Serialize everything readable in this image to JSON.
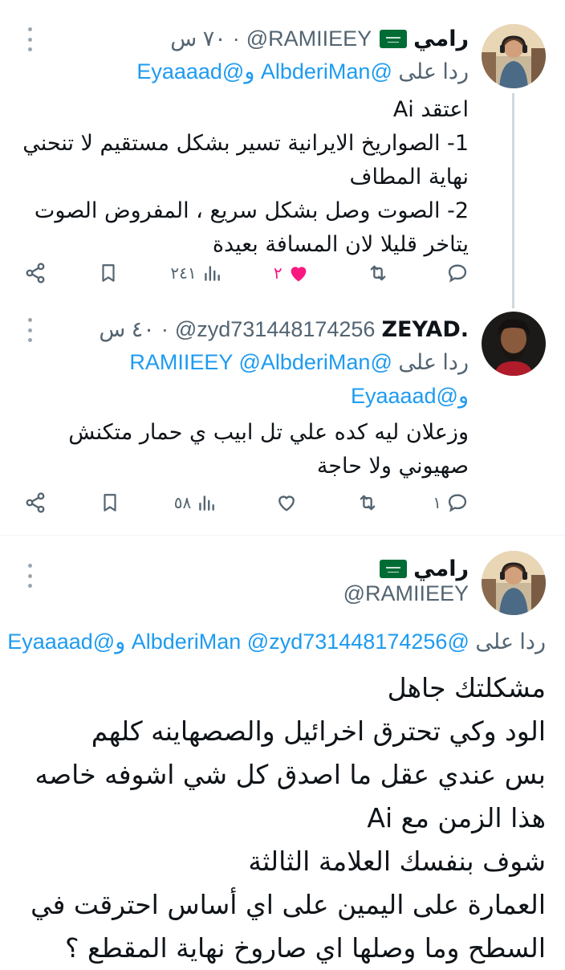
{
  "tweets": [
    {
      "name": "رامي",
      "handle": "@RAMIIEEY",
      "time": "٧٠ س",
      "reply_prefix": "ردا على",
      "reply_mentions": "@AlbderiMan و@Eyaaaad",
      "text": "اعتقد Ai\n1- الصواريخ الايرانية تسير بشكل مستقيم لا تنحني نهاية المطاف\n2- الصوت وصل بشكل سريع ، المفروض الصوت يتاخر قليلا لان المسافة بعيدة",
      "actions": {
        "reply_count": "",
        "retweet_count": "",
        "like_count": "٢",
        "views_count": "٢٤١"
      },
      "like_color": "#f91880"
    },
    {
      "name": "ZEYAD.",
      "handle": "@zyd731448174256",
      "time": "٤٠ س",
      "reply_prefix": "ردا على",
      "reply_mentions": "@RAMIIEEY @AlbderiMan",
      "reply_mentions_2": "و@Eyaaaad",
      "text": "وزعلان ليه كده علي تل ابيب ي حمار متكنش صهيوني ولا حاجة",
      "actions": {
        "reply_count": "١",
        "retweet_count": "",
        "like_count": "",
        "views_count": "٥٨"
      }
    },
    {
      "name": "رامي",
      "handle": "@RAMIIEEY",
      "reply_prefix": "ردا على",
      "reply_mentions": "@AlbderiMan @zyd731448174256 و@Eyaaaad",
      "text": "مشكلتك جاهل\nالود وكي تحترق اخرائيل والصصهاينه كلهم\nبس عندي عقل ما اصدق كل شي اشوفه خاصه هذا الزمن مع Ai\nشوف بنفسك العلامة الثالثة\nالعمارة على اليمين على اي أساس احترقت في السطح وما وصلها اي صاروخ نهاية المقطع ؟"
    }
  ],
  "colors": {
    "accent": "#1d9bf0",
    "muted": "#536471",
    "like": "#f91880",
    "flag_green": "#006c35"
  },
  "icons": [
    "more-icon",
    "reply-icon",
    "retweet-icon",
    "heart-icon",
    "views-icon",
    "bookmark-icon",
    "share-icon",
    "saudi-flag-icon"
  ]
}
